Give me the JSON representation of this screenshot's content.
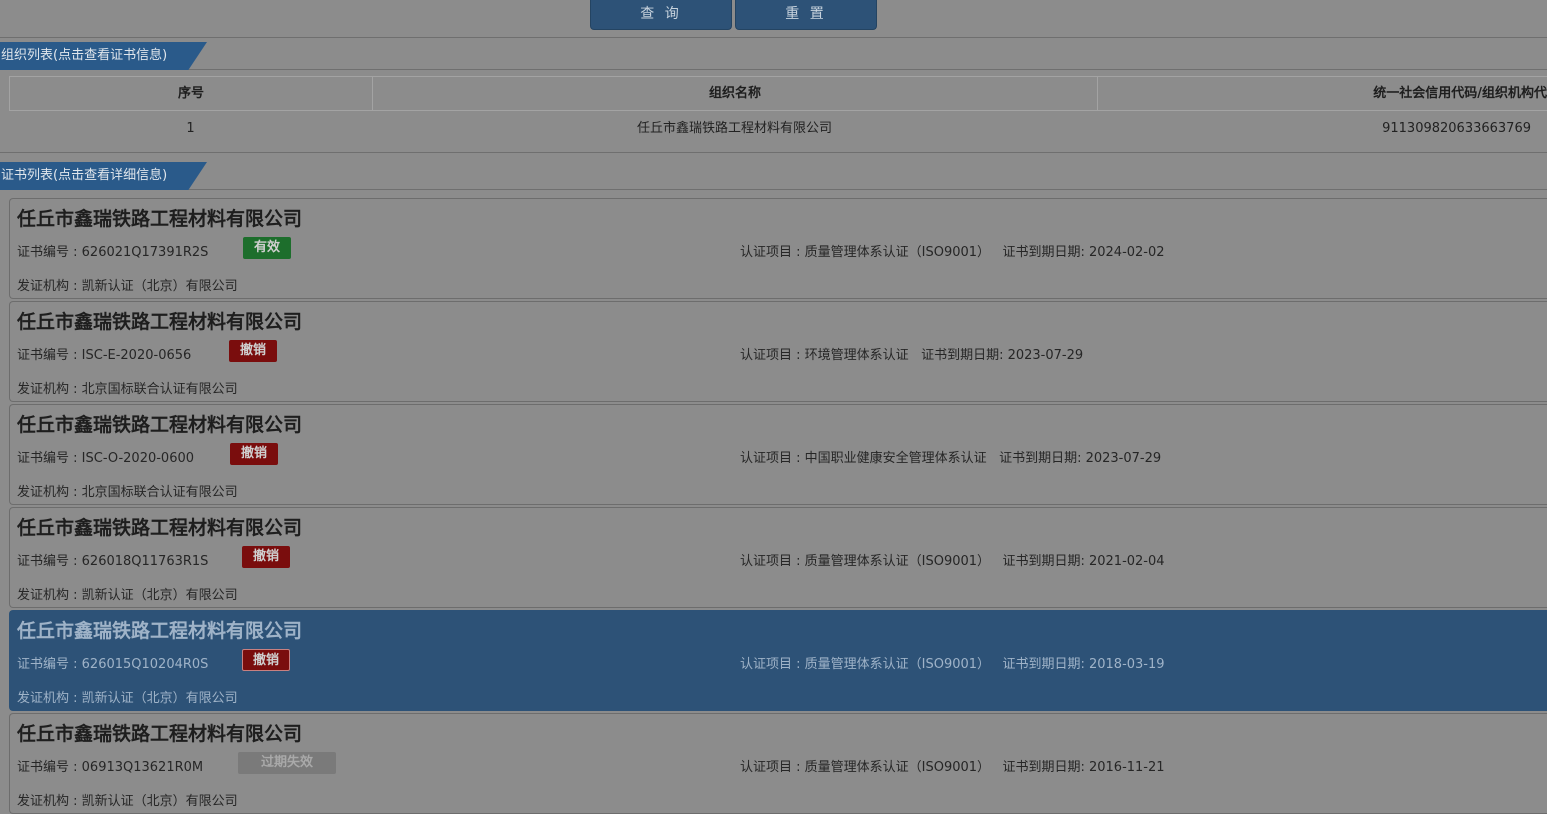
{
  "toolbar": {
    "query_label": "查 询",
    "reset_label": "重 置"
  },
  "org_section": {
    "title": "组织列表(点击查看证书信息)"
  },
  "org_table": {
    "headers": [
      "序号",
      "组织名称",
      "统一社会信用代码/组织机构代"
    ],
    "rows": [
      [
        "1",
        "任丘市鑫瑞铁路工程材料有限公司",
        "911309820633663769"
      ]
    ]
  },
  "cert_section": {
    "title": "证书列表(点击查看详细信息)"
  },
  "labels": {
    "cert_no": "证书编号 : ",
    "project": "认证项目 : ",
    "expiry": "证书到期日期: ",
    "issuer": "发证机构 : "
  },
  "certificates": [
    {
      "org": "任丘市鑫瑞铁路工程材料有限公司",
      "cert_no": "626021Q17391R2S",
      "status": "有效",
      "project": "质量管理体系认证（ISO9001）",
      "expiry": "2024-02-02",
      "issuer": "凯新认证（北京）有限公司"
    },
    {
      "org": "任丘市鑫瑞铁路工程材料有限公司",
      "cert_no": "ISC-E-2020-0656",
      "status": "撤销",
      "project": "环境管理体系认证",
      "expiry": "2023-07-29",
      "issuer": "北京国标联合认证有限公司"
    },
    {
      "org": "任丘市鑫瑞铁路工程材料有限公司",
      "cert_no": "ISC-O-2020-0600",
      "status": "撤销",
      "project": "中国职业健康安全管理体系认证",
      "expiry": "2023-07-29",
      "issuer": "北京国标联合认证有限公司"
    },
    {
      "org": "任丘市鑫瑞铁路工程材料有限公司",
      "cert_no": "626018Q11763R1S",
      "status": "撤销",
      "project": "质量管理体系认证（ISO9001）",
      "expiry": "2021-02-04",
      "issuer": "凯新认证（北京）有限公司"
    },
    {
      "org": "任丘市鑫瑞铁路工程材料有限公司",
      "cert_no": "626015Q10204R0S",
      "status": "撤销",
      "project": "质量管理体系认证（ISO9001）",
      "expiry": "2018-03-19",
      "issuer": "凯新认证（北京）有限公司"
    },
    {
      "org": "任丘市鑫瑞铁路工程材料有限公司",
      "cert_no": "06913Q13621R0M",
      "status": "过期失效",
      "project": "质量管理体系认证（ISO9001）",
      "expiry": "2016-11-21",
      "issuer": "凯新认证（北京）有限公司"
    }
  ],
  "colors": {
    "valid": "#1d6e2c",
    "revoked": "#7a0d0d",
    "expired": "#7a7a7a",
    "selected": "#2d5277",
    "accent": "#2a5a8a"
  }
}
